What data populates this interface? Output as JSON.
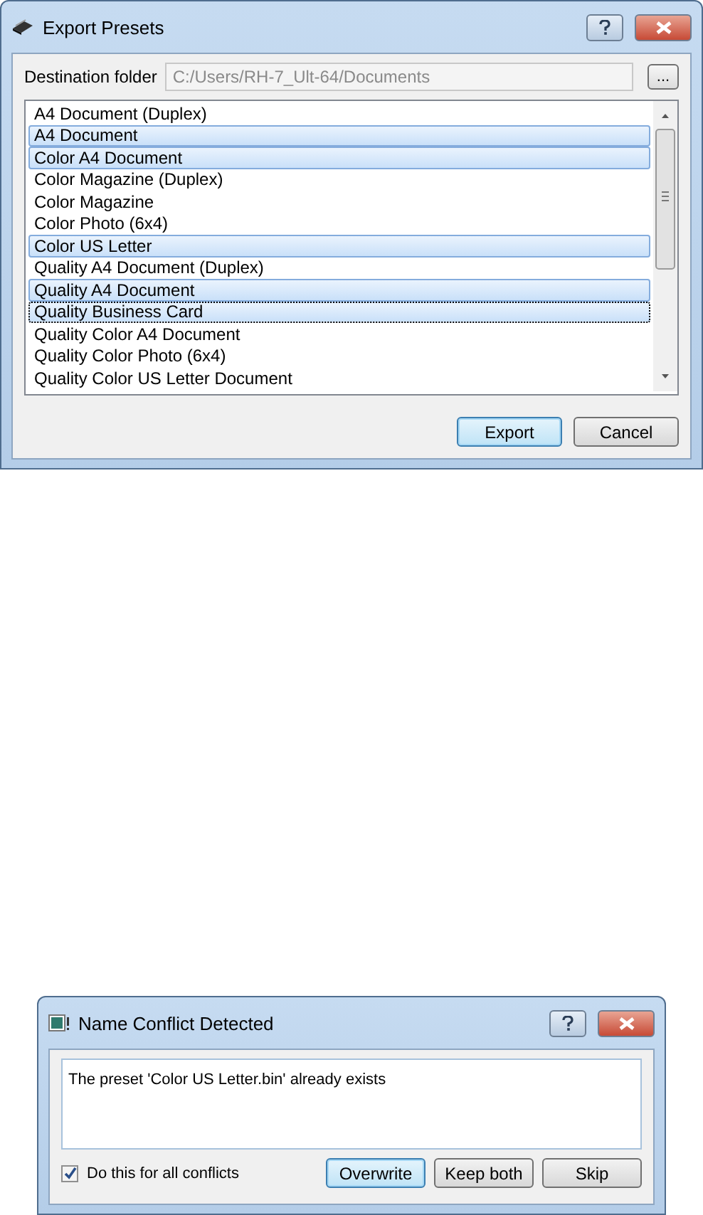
{
  "export_dialog": {
    "title": "Export Presets",
    "destination": {
      "label": "Destination folder",
      "value": "C:/Users/RH-7_Ult-64/Documents",
      "disabled": true,
      "browse_button": "..."
    },
    "presets": [
      {
        "label": "A4 Document (Duplex)",
        "selected": false,
        "focused": false
      },
      {
        "label": "A4 Document",
        "selected": true,
        "focused": false
      },
      {
        "label": "Color A4 Document",
        "selected": true,
        "focused": false
      },
      {
        "label": "Color Magazine (Duplex)",
        "selected": false,
        "focused": false
      },
      {
        "label": "Color Magazine",
        "selected": false,
        "focused": false
      },
      {
        "label": "Color Photo (6x4)",
        "selected": false,
        "focused": false
      },
      {
        "label": "Color US Letter",
        "selected": true,
        "focused": false
      },
      {
        "label": "Quality A4 Document (Duplex)",
        "selected": false,
        "focused": false
      },
      {
        "label": "Quality A4 Document",
        "selected": true,
        "focused": false
      },
      {
        "label": "Quality Business Card",
        "selected": true,
        "focused": true
      },
      {
        "label": "Quality Color A4 Document",
        "selected": false,
        "focused": false
      },
      {
        "label": "Quality Color Photo (6x4)",
        "selected": false,
        "focused": false
      },
      {
        "label": "Quality Color US Letter Document",
        "selected": false,
        "focused": false
      }
    ],
    "buttons": [
      {
        "label": "Export",
        "default": true
      },
      {
        "label": "Cancel",
        "default": false
      }
    ]
  },
  "conflict_dialog": {
    "title": "Name Conflict Detected",
    "message": "The preset 'Color US Letter.bin' already exists",
    "apply_to_all": {
      "label": "Do this for all conflicts",
      "checked": true
    },
    "buttons": [
      {
        "label": "Overwrite",
        "default": true
      },
      {
        "label": "Keep both",
        "default": false
      },
      {
        "label": "Skip",
        "default": false
      }
    ]
  }
}
